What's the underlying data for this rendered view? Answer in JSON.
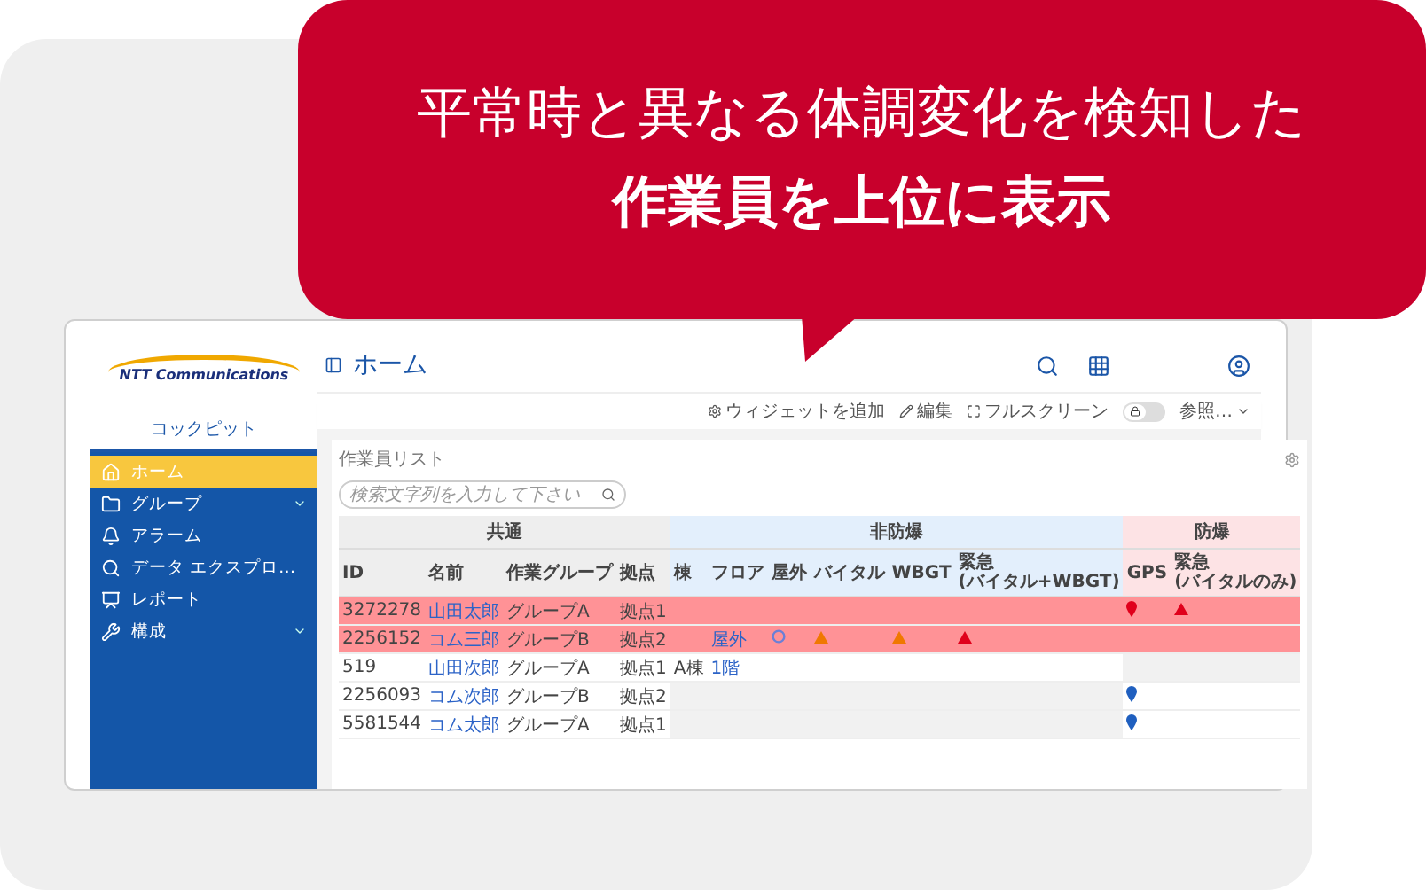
{
  "callout": {
    "lines": [
      {
        "text": "平常時と異なる体調変化を検知した",
        "bold": false
      },
      {
        "text": "作業員を上位に表示",
        "bold": true
      }
    ]
  },
  "app": {
    "logo": "NTT Communications",
    "sidebar": {
      "title": "コックピット",
      "items": [
        {
          "label": "ホーム",
          "selected": true,
          "expandable": false
        },
        {
          "label": "グループ",
          "selected": false,
          "expandable": true
        },
        {
          "label": "アラーム",
          "selected": false,
          "expandable": false
        },
        {
          "label": "データ エクスプロ…",
          "selected": false,
          "expandable": false
        },
        {
          "label": "レポート",
          "selected": false,
          "expandable": false
        },
        {
          "label": "構成",
          "selected": false,
          "expandable": true
        }
      ]
    },
    "page_title": "ホーム",
    "toolbar": {
      "add_widget": "ウィジェットを追加",
      "edit": "編集",
      "fullscreen": "フルスクリーン",
      "lock_toggle": {
        "on": false
      },
      "view": "参照…"
    },
    "widget": {
      "title": "作業員リスト",
      "search": {
        "placeholder": "検索文字列を入力して下さい"
      },
      "table": {
        "groups": [
          {
            "label": "共通",
            "color": "#eeeeee",
            "columns": [
              "ID",
              "名前",
              "作業グループ",
              "拠点"
            ]
          },
          {
            "label": "非防爆",
            "color": "#e3effc",
            "columns": [
              "棟",
              "フロア",
              "屋外",
              "バイタル",
              "WBGT",
              "緊急\n(バイタル+WBGT)"
            ]
          },
          {
            "label": "防爆",
            "color": "#fde3e5",
            "columns": [
              "GPS",
              "緊急\n(バイタルのみ)"
            ]
          }
        ],
        "rows": [
          {
            "alert": true,
            "cells": [
              {
                "kind": "text",
                "text": "3272278"
              },
              {
                "kind": "link",
                "text": "山田太郎"
              },
              {
                "kind": "text",
                "text": "グループA"
              },
              {
                "kind": "text",
                "text": "拠点1"
              },
              null,
              null,
              null,
              null,
              null,
              null,
              {
                "kind": "pin",
                "color": "#e0001b"
              },
              {
                "kind": "triangle",
                "color": "#e0001b"
              }
            ]
          },
          {
            "alert": true,
            "cells": [
              {
                "kind": "text",
                "text": "2256152"
              },
              {
                "kind": "link",
                "text": "コム三郎"
              },
              {
                "kind": "text",
                "text": "グループB"
              },
              {
                "kind": "text",
                "text": "拠点2"
              },
              null,
              {
                "kind": "link",
                "text": "屋外"
              },
              {
                "kind": "circle",
                "color": "#6b7fd6"
              },
              {
                "kind": "triangle",
                "color": "#f07800"
              },
              {
                "kind": "triangle",
                "color": "#f07800"
              },
              {
                "kind": "triangle",
                "color": "#e0001b"
              },
              null,
              null
            ]
          },
          {
            "alert": false,
            "cells": [
              {
                "kind": "text",
                "text": "519"
              },
              {
                "kind": "link",
                "text": "山田次郎"
              },
              {
                "kind": "text",
                "text": "グループA"
              },
              {
                "kind": "text",
                "text": "拠点1"
              },
              {
                "kind": "text",
                "text": "A棟"
              },
              {
                "kind": "link",
                "text": "1階"
              },
              null,
              null,
              null,
              null,
              {
                "kind": "unavailable"
              },
              {
                "kind": "unavailable"
              }
            ]
          },
          {
            "alert": false,
            "cells": [
              {
                "kind": "text",
                "text": "2256093"
              },
              {
                "kind": "link",
                "text": "コム次郎"
              },
              {
                "kind": "text",
                "text": "グループB"
              },
              {
                "kind": "text",
                "text": "拠点2"
              },
              {
                "kind": "unavailable"
              },
              {
                "kind": "unavailable"
              },
              {
                "kind": "unavailable"
              },
              {
                "kind": "unavailable"
              },
              {
                "kind": "unavailable"
              },
              {
                "kind": "unavailable"
              },
              {
                "kind": "pin",
                "color": "#1f5fbf"
              },
              null
            ]
          },
          {
            "alert": false,
            "cells": [
              {
                "kind": "text",
                "text": "5581544"
              },
              {
                "kind": "link",
                "text": "コム太郎"
              },
              {
                "kind": "text",
                "text": "グループA"
              },
              {
                "kind": "text",
                "text": "拠点1"
              },
              {
                "kind": "unavailable"
              },
              {
                "kind": "unavailable"
              },
              {
                "kind": "unavailable"
              },
              {
                "kind": "unavailable"
              },
              {
                "kind": "unavailable"
              },
              {
                "kind": "unavailable"
              },
              {
                "kind": "pin",
                "color": "#1f5fbf"
              },
              null
            ]
          }
        ]
      }
    }
  }
}
